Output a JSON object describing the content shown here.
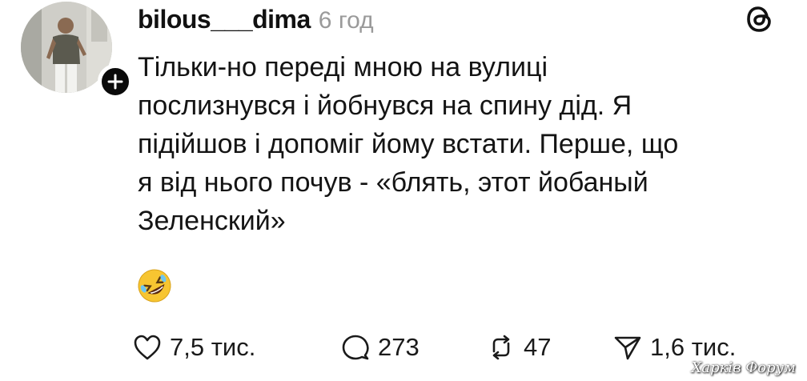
{
  "post": {
    "username": "bilous___dima",
    "timestamp": "6 год",
    "body_lines": [
      "Тільки-но переді мною на вулиці",
      "послизнувся і йобнувся на спину дід. Я",
      "підійшов і допоміг йому встати. Перше, що",
      "я від нього почув - «блять, этот йобаный",
      "Зеленский»"
    ],
    "emoji": "rolling-on-floor-laughing",
    "actions": {
      "likes": "7,5 тис.",
      "comments": "273",
      "reposts": "47",
      "shares": "1,6 тис."
    }
  },
  "watermark": "Харків Форум",
  "colors": {
    "text": "#111111",
    "timestamp": "#9a9a9a",
    "badge": "#0a0a0a"
  }
}
